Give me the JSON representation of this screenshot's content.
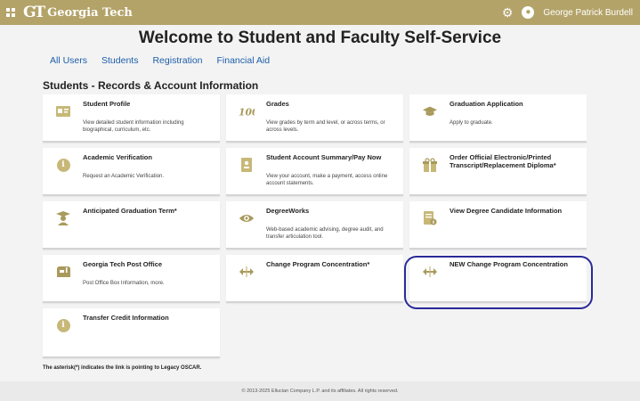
{
  "header": {
    "brand": "Georgia Tech",
    "logo_letters": "GT",
    "user_name": "George Patrick Burdell",
    "icons": {
      "menu": "grid-icon",
      "settings": "gear-icon",
      "user": "user-icon"
    }
  },
  "page_title": "Welcome to Student and Faculty Self-Service",
  "tabs": [
    "All Users",
    "Students",
    "Registration",
    "Financial Aid"
  ],
  "section_title": "Students - Records & Account Information",
  "cards": [
    {
      "title": "Student Profile",
      "desc": "View detailed student information including biographical, curriculum, etc.",
      "icon": "id-card-icon"
    },
    {
      "title": "Grades",
      "desc": "View grades by term and level, or across terms, or across levels.",
      "icon": "grades-100-icon"
    },
    {
      "title": "Graduation Application",
      "desc": "Apply to graduate.",
      "icon": "graduation-cap-icon"
    },
    {
      "title": "Academic Verification",
      "desc": "Request an Academic Verification.",
      "icon": "info-icon"
    },
    {
      "title": "Student Account Summary/Pay Now",
      "desc": "View your account, make a payment, access online account statements.",
      "icon": "account-document-icon"
    },
    {
      "title": "Order Official Electronic/Printed Transcript/Replacement Diploma*",
      "desc": "",
      "icon": "gift-icon"
    },
    {
      "title": "Anticipated Graduation Term*",
      "desc": "",
      "icon": "graduate-icon"
    },
    {
      "title": "DegreeWorks",
      "desc": "Web-based academic advising, degree audit, and transfer articulation tool.",
      "icon": "eye-icon"
    },
    {
      "title": "View Degree Candidate Information",
      "desc": "",
      "icon": "document-info-icon"
    },
    {
      "title": "Georgia Tech Post Office",
      "desc": "Post Office Box Information, more.",
      "icon": "mailbox-icon"
    },
    {
      "title": "Change Program Concentration*",
      "desc": "",
      "icon": "move-arrows-icon"
    },
    {
      "title": "NEW Change Program Concentration",
      "desc": "",
      "icon": "move-arrows-icon"
    },
    {
      "title": "Transfer Credit Information",
      "desc": "",
      "icon": "info-icon"
    }
  ],
  "footnote": "The asterisk(*) indicates the link is pointing to Legacy OSCAR.",
  "footer": "© 2013-2025 Ellucian Company L.P. and its affiliates. All rights reserved.",
  "colors": {
    "brand": "#b3a369",
    "link": "#1c5ea9",
    "highlight_ring": "#2a2a9a",
    "icon": "#a99a5c"
  }
}
